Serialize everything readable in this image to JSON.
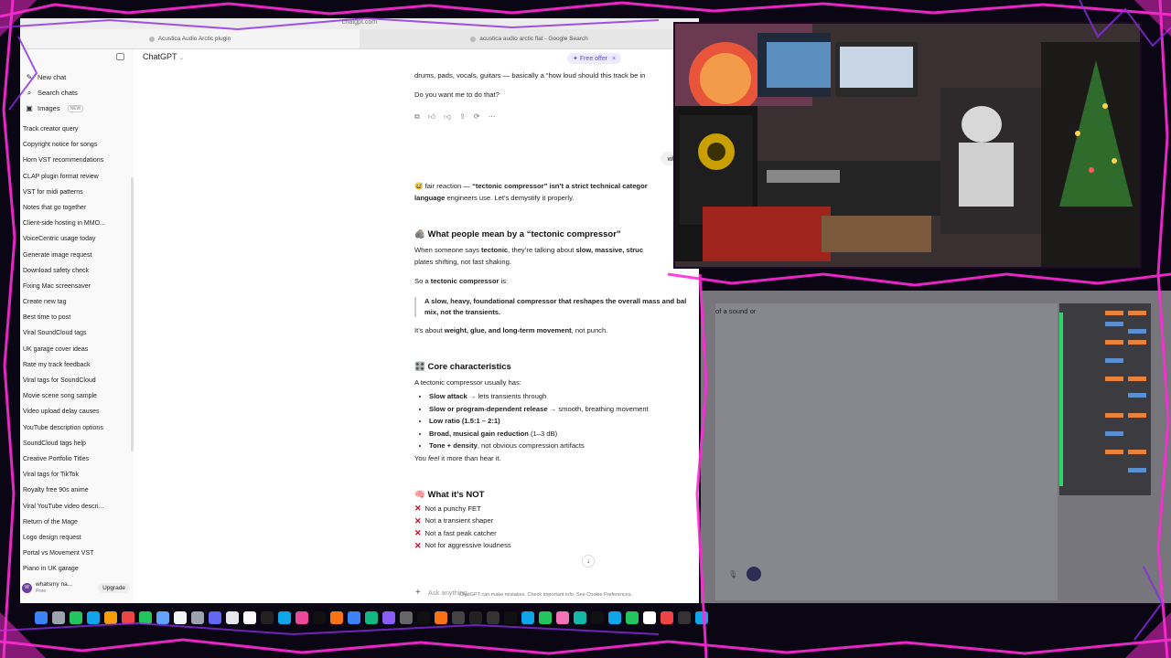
{
  "browser": {
    "url": "chatgpt.com",
    "tabs": [
      {
        "title": "Acustica Audio Arctic plugin"
      },
      {
        "title": "acustica audio arctic flat - Google Search"
      }
    ]
  },
  "sidebar": {
    "nav": [
      {
        "label": "New chat",
        "icon": "new-chat-icon"
      },
      {
        "label": "Search chats",
        "icon": "search-icon"
      },
      {
        "label": "Images",
        "icon": "images-icon",
        "badge": "NEW"
      }
    ],
    "chats": [
      "Track creator query",
      "Copyright notice for songs",
      "Horn VST recommendations",
      "CLAP plugin format review",
      "VST for midi patterns",
      "Notes that go together",
      "Client-side hosting in MMO...",
      "VoiceCentric usage today",
      "Generate image request",
      "Download safety check",
      "Fixing Mac screensaver",
      "Create new tag",
      "Best time to post",
      "Viral SoundCloud tags",
      "UK garage cover ideas",
      "Rate my track feedback",
      "Viral tags for SoundCloud",
      "Movie scene song sample",
      "Video upload delay causes",
      "YouTube description options",
      "SoundCloud tags help",
      "Creative Portfolio Titles",
      "Viral tags for TikTok",
      "Royalty free 90s anime",
      "Viral YouTube video descri...",
      "Return of the Mage",
      "Logo design request",
      "Portal vs Movement VST",
      "Piano in UK garage"
    ],
    "user": {
      "name": "whatsmy na...",
      "plan": "Free",
      "upgrade_label": "Upgrade"
    }
  },
  "chat": {
    "model": "ChatGPT",
    "offer": "Free offer",
    "prev_answer_tail": "drums, pads, vocals, guitars — basically a “how loud should this track be in",
    "prev_question": "Do you want me to do that?",
    "user_message": "what the",
    "intro_emoji": "😅",
    "intro_a": " fair reaction — ",
    "intro_b": "“tectonic compressor” isn’t a strict technical categor",
    "intro_c": "language",
    "intro_d": " engineers use. Let’s demystify it properly.",
    "section1_emoji": "🪨",
    "section1_title": "What people mean by a “tectonic compressor”",
    "s1_line_a": "When someone says ",
    "s1_line_b": "tectonic",
    "s1_line_c": ", they’re talking about ",
    "s1_line_d": "slow, massive, struc",
    "s1_line_e": "plates shifting, not fast shaking.",
    "s1_so_a": "So a ",
    "s1_so_b": "tectonic compressor",
    "s1_so_c": " is:",
    "quote_a": "A slow, heavy, foundational compressor that reshapes the overall mass and bal",
    "quote_b": "mix, not the transients.",
    "about_a": "It’s about ",
    "about_b": "weight, glue, and long-term movement",
    "about_c": ", not punch.",
    "section2_emoji": "🎛️",
    "section2_title": "Core characteristics",
    "s2_intro": "A tectonic compressor usually has:",
    "characteristics": [
      {
        "bold": "Slow attack",
        "rest": " → lets transients through"
      },
      {
        "bold": "Slow or program-dependent release",
        "rest": " → smooth, breathing movement"
      },
      {
        "bold": "Low ratio (1.5:1 – 2:1)",
        "rest": ""
      },
      {
        "bold": "Broad, musical gain reduction",
        "rest": " (1–3 dB)"
      },
      {
        "bold": "Tone + density",
        "rest": ", not obvious compression artifacts"
      }
    ],
    "feel_a": "You ",
    "feel_b": "feel",
    "feel_c": " it more than hear it.",
    "section3_emoji": "🧠",
    "section3_title": "What it’s NOT",
    "nots": [
      "Not a punchy FET",
      "Not a transient shaper",
      "Not a fast peak catcher",
      "Not for aggressive loudness"
    ],
    "composer_placeholder": "Ask anything",
    "disclaimer": "ChatGPT can make mistakes. Check important info. See Cookie Preferences."
  },
  "daw": {
    "bleed_text": "of a sound or"
  },
  "colors": {
    "neon_pink": "#ff2bd6",
    "neon_purple": "#8a2be2",
    "accent": "#5b4fd9",
    "x_red": "#d0021b"
  }
}
